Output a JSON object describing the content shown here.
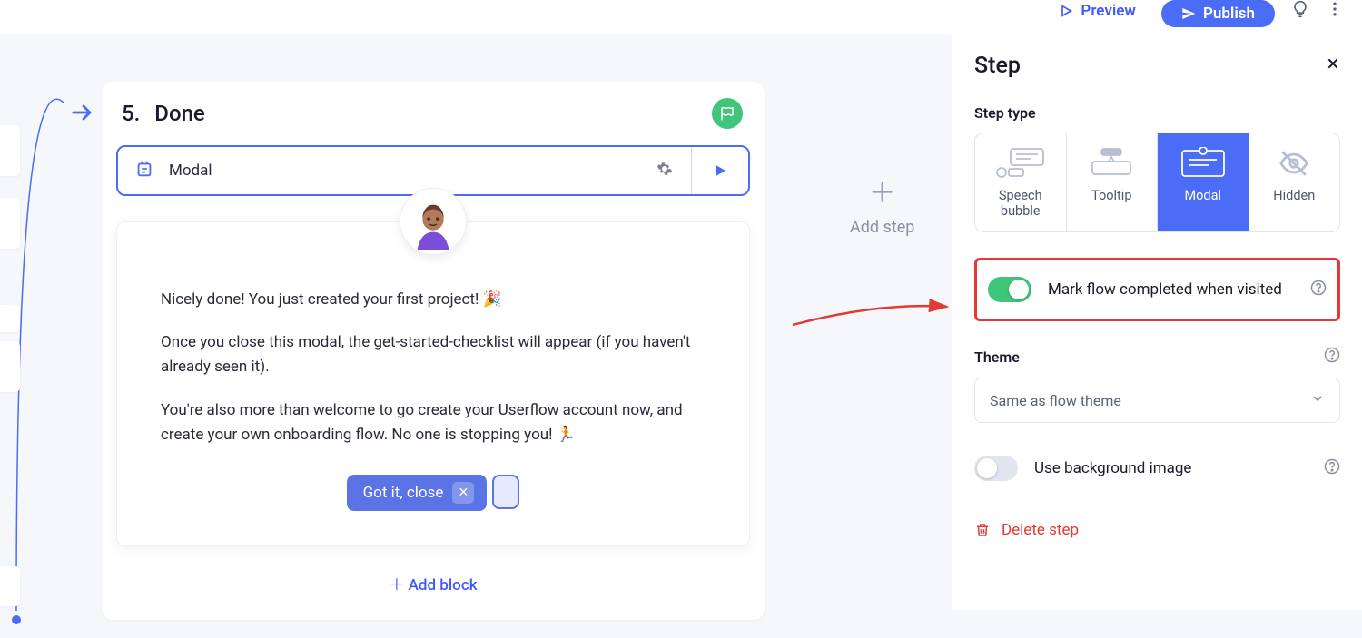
{
  "header": {
    "preview": "Preview",
    "publish": "Publish"
  },
  "step": {
    "number": "5.",
    "title": "Done",
    "block_type": "Modal",
    "body_p1": "Nicely done! You just created your first project! 🎉",
    "body_p2": "Once you close this modal, the get-started-checklist will appear (if you haven't already seen it).",
    "body_p3": "You're also more than welcome to go create your Userflow account now, and create your own onboarding flow. No one is stopping you! 🏃",
    "cta": "Got it, close",
    "add_block": "Add block"
  },
  "add_step": "Add step",
  "sidebar": {
    "title": "Step",
    "step_type_label": "Step type",
    "types": {
      "speech": "Speech bubble",
      "tooltip": "Tooltip",
      "modal": "Modal",
      "hidden": "Hidden"
    },
    "mark_complete": "Mark flow completed when visited",
    "theme_label": "Theme",
    "theme_value": "Same as flow theme",
    "bg_image": "Use background image",
    "delete": "Delete step"
  }
}
